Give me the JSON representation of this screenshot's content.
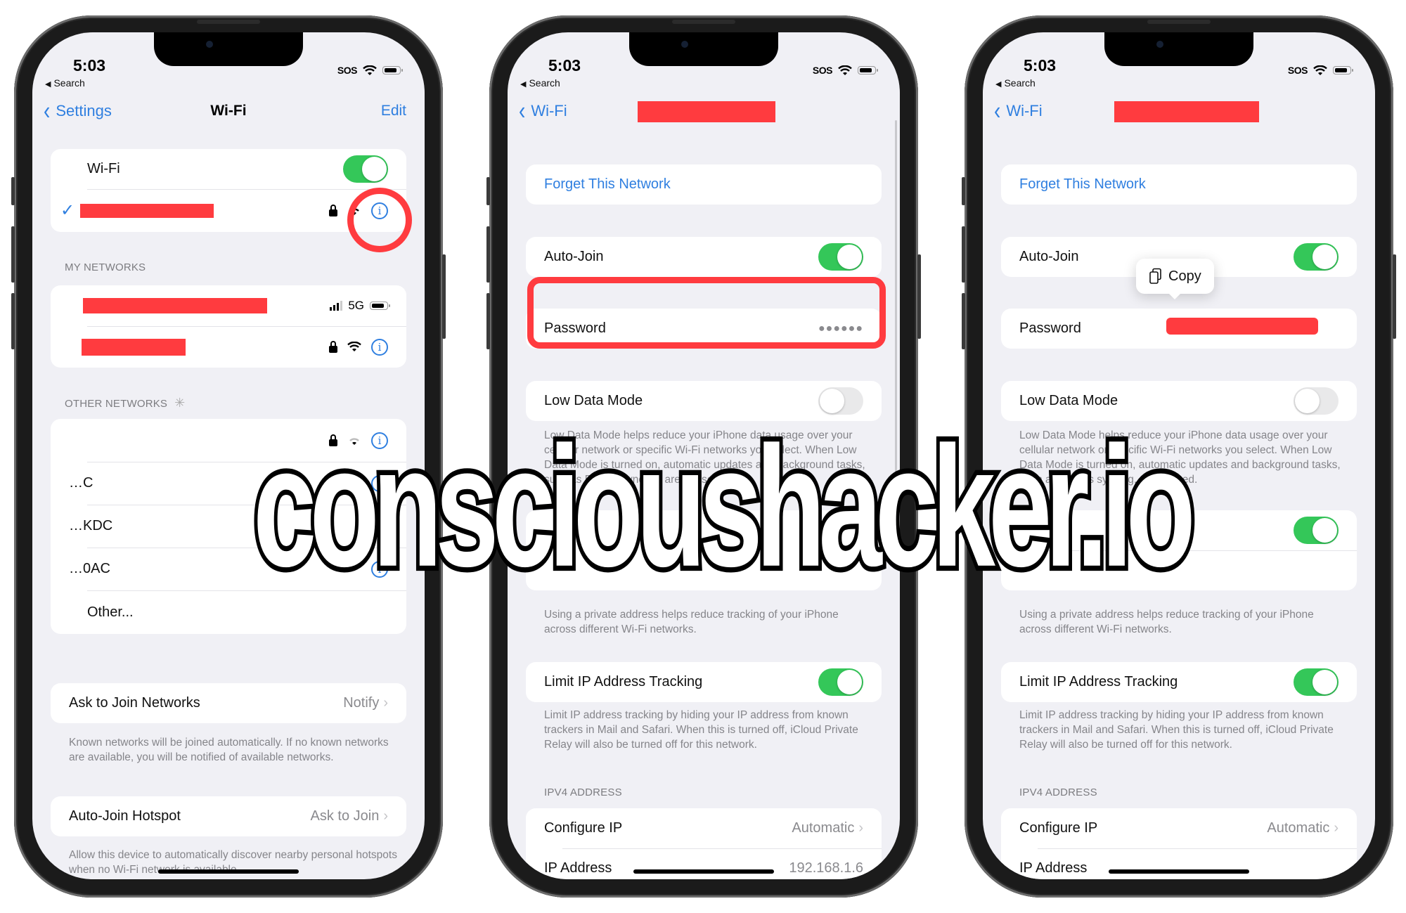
{
  "status_bar": {
    "time": "5:03",
    "back_app": "Search",
    "carrier": "SOS"
  },
  "phone1": {
    "nav": {
      "back_label": "Settings",
      "title": "Wi-Fi",
      "edit_label": "Edit"
    },
    "wifi_toggle_label": "Wi-Fi",
    "wifi_on": true,
    "current_network_checkmark": "✓",
    "my_networks_header": "MY NETWORKS",
    "hotspot_badge": "5G",
    "other_networks_header": "OTHER NETWORKS",
    "other_networks_partial": [
      "",
      "…C",
      "…KDC",
      "…0AC"
    ],
    "other_label": "Other...",
    "ask_to_join": {
      "label": "Ask to Join Networks",
      "value": "Notify"
    },
    "ask_to_join_footer": "Known networks will be joined automatically. If no known networks are available, you will be notified of available networks.",
    "auto_join_hotspot": {
      "label": "Auto-Join Hotspot",
      "value": "Ask to Join"
    },
    "auto_join_hotspot_footer": "Allow this device to automatically discover nearby personal hotspots when no Wi-Fi network is available."
  },
  "phone2": {
    "nav": {
      "back_label": "Wi-Fi"
    },
    "forget_label": "Forget This Network",
    "auto_join_label": "Auto-Join",
    "auto_join_on": true,
    "password_label": "Password",
    "password_masked": "●●●●●●",
    "low_data_label": "Low Data Mode",
    "low_data_on": false,
    "low_data_footer": "Low Data Mode helps reduce your iPhone data usage over your cellular network or specific Wi-Fi networks you select. When Low Data Mode is turned on, automatic updates and background tasks, such as Photos syncing, are paused.",
    "private_address_footer": "Using a private address helps reduce tracking of your iPhone across different Wi-Fi networks.",
    "limit_ip_label": "Limit IP Address Tracking",
    "limit_ip_on": true,
    "limit_ip_footer": "Limit IP address tracking by hiding your IP address from known trackers in Mail and Safari. When this is turned off, iCloud Private Relay will also be turned off for this network.",
    "ipv4_header": "IPV4 ADDRESS",
    "configure_ip": {
      "label": "Configure IP",
      "value": "Automatic"
    },
    "ip_address": {
      "label": "IP Address",
      "value": "192.168.1.6"
    }
  },
  "phone3": {
    "nav": {
      "back_label": "Wi-Fi"
    },
    "forget_label": "Forget This Network",
    "auto_join_label": "Auto-Join",
    "copy_label": "Copy",
    "password_label": "Password",
    "low_data_label": "Low Data Mode",
    "low_data_footer": "Low Data Mode helps reduce your iPhone data usage over your cellular network or specific Wi-Fi networks you select. When Low Data Mode is turned on, automatic updates and background tasks, such as Photos syncing, are paused.",
    "private_address_row_partial": "…s",
    "private_address_footer": "Using a private address helps reduce tracking of your iPhone across different Wi-Fi networks.",
    "limit_ip_label": "Limit IP Address Tracking",
    "limit_ip_footer": "Limit IP address tracking by hiding your IP address from known trackers in Mail and Safari. When this is turned off, iCloud Private Relay will also be turned off for this network.",
    "ipv4_header": "IPV4 ADDRESS",
    "configure_ip": {
      "label": "Configure IP",
      "value": "Automatic"
    },
    "ip_address": {
      "label": "IP Address"
    }
  },
  "watermark": "conscioushacker.io",
  "colors": {
    "accent_blue": "#2f7fe0",
    "toggle_green": "#34c759",
    "redaction_red": "#ff3b3f",
    "background": "#f0f0f5"
  }
}
